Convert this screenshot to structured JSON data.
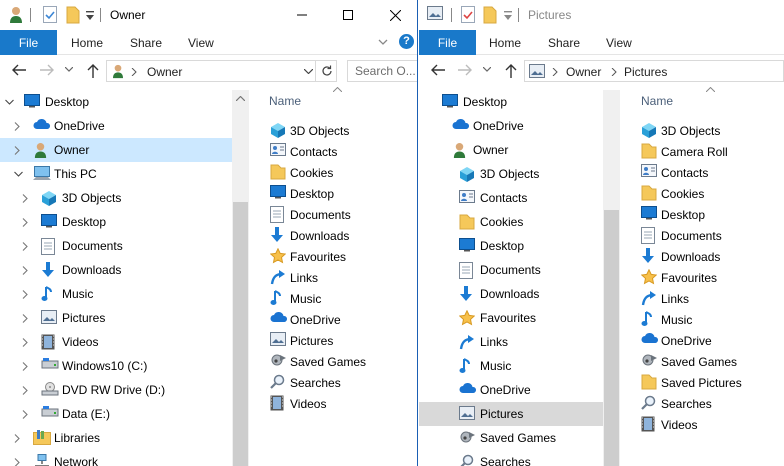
{
  "left_window": {
    "title": "Owner",
    "ribbon_tabs": [
      "File",
      "Home",
      "Share",
      "View"
    ],
    "help_label": "?",
    "address": {
      "crumbs": [
        "Owner"
      ]
    },
    "search_placeholder": "Search O...",
    "nav_tree": [
      {
        "label": "Desktop",
        "icon": "desktop-icon",
        "expander": "expanded",
        "level": 0
      },
      {
        "label": "OneDrive",
        "icon": "onedrive-icon",
        "expander": "collapsed",
        "level": 1
      },
      {
        "label": "Owner",
        "icon": "user-icon",
        "expander": "collapsed",
        "level": 1,
        "selected": true
      },
      {
        "label": "This PC",
        "icon": "this-pc-icon",
        "expander": "expanded",
        "level": 1
      },
      {
        "label": "3D Objects",
        "icon": "3d-objects-icon",
        "expander": "collapsed",
        "level": 2
      },
      {
        "label": "Desktop",
        "icon": "desktop-icon",
        "expander": "collapsed",
        "level": 2
      },
      {
        "label": "Documents",
        "icon": "documents-icon",
        "expander": "collapsed",
        "level": 2
      },
      {
        "label": "Downloads",
        "icon": "downloads-icon",
        "expander": "collapsed",
        "level": 2
      },
      {
        "label": "Music",
        "icon": "music-icon",
        "expander": "collapsed",
        "level": 2
      },
      {
        "label": "Pictures",
        "icon": "pictures-icon",
        "expander": "collapsed",
        "level": 2
      },
      {
        "label": "Videos",
        "icon": "videos-icon",
        "expander": "collapsed",
        "level": 2
      },
      {
        "label": "Windows10 (C:)",
        "icon": "drive-icon",
        "expander": "collapsed",
        "level": 2
      },
      {
        "label": "DVD RW Drive (D:)",
        "icon": "dvd-drive-icon",
        "expander": "collapsed",
        "level": 2
      },
      {
        "label": "Data (E:)",
        "icon": "drive-icon",
        "expander": "collapsed",
        "level": 2
      },
      {
        "label": "Libraries",
        "icon": "libraries-icon",
        "expander": "collapsed",
        "level": 1
      },
      {
        "label": "Network",
        "icon": "network-icon",
        "expander": "collapsed",
        "level": 1
      }
    ],
    "content_header": "Name",
    "items": [
      {
        "label": "3D Objects",
        "icon": "3d-objects-icon"
      },
      {
        "label": "Contacts",
        "icon": "contacts-icon"
      },
      {
        "label": "Cookies",
        "icon": "folder-icon"
      },
      {
        "label": "Desktop",
        "icon": "desktop-icon"
      },
      {
        "label": "Documents",
        "icon": "documents-icon"
      },
      {
        "label": "Downloads",
        "icon": "downloads-icon"
      },
      {
        "label": "Favourites",
        "icon": "favourites-icon"
      },
      {
        "label": "Links",
        "icon": "links-icon"
      },
      {
        "label": "Music",
        "icon": "music-icon"
      },
      {
        "label": "OneDrive",
        "icon": "onedrive-icon"
      },
      {
        "label": "Pictures",
        "icon": "pictures-icon"
      },
      {
        "label": "Saved Games",
        "icon": "saved-games-icon"
      },
      {
        "label": "Searches",
        "icon": "searches-icon"
      },
      {
        "label": "Videos",
        "icon": "videos-icon"
      }
    ]
  },
  "right_window": {
    "title": "Pictures",
    "ribbon_tabs": [
      "File",
      "Home",
      "Share",
      "View"
    ],
    "address": {
      "crumbs": [
        "Owner",
        "Pictures"
      ]
    },
    "nav_tree": [
      {
        "label": "Desktop",
        "icon": "desktop-icon",
        "level": 0
      },
      {
        "label": "OneDrive",
        "icon": "onedrive-icon",
        "level": 1
      },
      {
        "label": "Owner",
        "icon": "user-icon",
        "level": 1
      },
      {
        "label": "3D Objects",
        "icon": "3d-objects-icon",
        "level": 2
      },
      {
        "label": "Contacts",
        "icon": "contacts-icon",
        "level": 2
      },
      {
        "label": "Cookies",
        "icon": "folder-icon",
        "level": 2
      },
      {
        "label": "Desktop",
        "icon": "desktop-icon",
        "level": 2
      },
      {
        "label": "Documents",
        "icon": "documents-icon",
        "level": 2
      },
      {
        "label": "Downloads",
        "icon": "downloads-icon",
        "level": 2
      },
      {
        "label": "Favourites",
        "icon": "favourites-icon",
        "level": 2
      },
      {
        "label": "Links",
        "icon": "links-icon",
        "level": 2
      },
      {
        "label": "Music",
        "icon": "music-icon",
        "level": 2
      },
      {
        "label": "OneDrive",
        "icon": "onedrive-icon",
        "level": 2
      },
      {
        "label": "Pictures",
        "icon": "pictures-icon",
        "level": 2,
        "highlighted": true
      },
      {
        "label": "Saved Games",
        "icon": "saved-games-icon",
        "level": 2
      },
      {
        "label": "Searches",
        "icon": "searches-icon",
        "level": 2
      }
    ],
    "content_header": "Name",
    "items": [
      {
        "label": "3D Objects",
        "icon": "3d-objects-icon"
      },
      {
        "label": "Camera Roll",
        "icon": "folder-icon"
      },
      {
        "label": "Contacts",
        "icon": "contacts-icon"
      },
      {
        "label": "Cookies",
        "icon": "folder-icon"
      },
      {
        "label": "Desktop",
        "icon": "desktop-icon"
      },
      {
        "label": "Documents",
        "icon": "documents-icon"
      },
      {
        "label": "Downloads",
        "icon": "downloads-icon"
      },
      {
        "label": "Favourites",
        "icon": "favourites-icon"
      },
      {
        "label": "Links",
        "icon": "links-icon"
      },
      {
        "label": "Music",
        "icon": "music-icon"
      },
      {
        "label": "OneDrive",
        "icon": "onedrive-icon"
      },
      {
        "label": "Saved Games",
        "icon": "saved-games-icon"
      },
      {
        "label": "Saved Pictures",
        "icon": "folder-icon"
      },
      {
        "label": "Searches",
        "icon": "searches-icon"
      },
      {
        "label": "Videos",
        "icon": "videos-icon"
      }
    ]
  },
  "colors": {
    "accent": "#1979ca",
    "selection": "#cce8ff",
    "highlight": "#d9d9d9",
    "folder": "#f5c85a"
  }
}
